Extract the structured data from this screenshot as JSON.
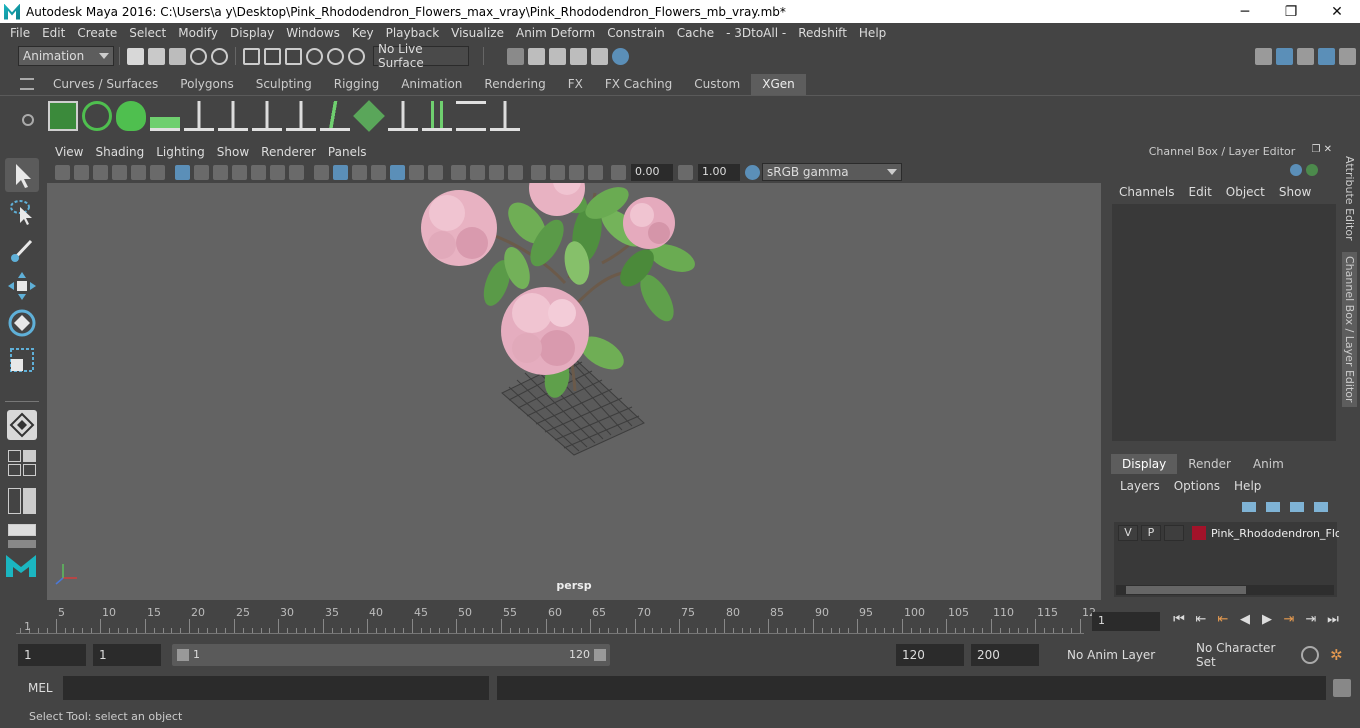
{
  "window": {
    "title": "Autodesk Maya 2016: C:\\Users\\a y\\Desktop\\Pink_Rhododendron_Flowers_max_vray\\Pink_Rhododendron_Flowers_mb_vray.mb*",
    "minimize": "─",
    "maximize": "❐",
    "close": "✕"
  },
  "menus": [
    "File",
    "Edit",
    "Create",
    "Select",
    "Modify",
    "Display",
    "Windows",
    "Key",
    "Playback",
    "Visualize",
    "Anim Deform",
    "Constrain",
    "Cache",
    "- 3DtoAll -",
    "Redshift",
    "Help"
  ],
  "status": {
    "mode": "Animation",
    "live_surface": "No Live Surface"
  },
  "shelf_tabs": [
    "Curves / Surfaces",
    "Polygons",
    "Sculpting",
    "Rigging",
    "Animation",
    "Rendering",
    "FX",
    "FX Caching",
    "Custom",
    "XGen"
  ],
  "shelf_active": "XGen",
  "viewport": {
    "menus": [
      "View",
      "Shading",
      "Lighting",
      "Show",
      "Renderer",
      "Panels"
    ],
    "near": "0.00",
    "far": "1.00",
    "color_space": "sRGB gamma",
    "camera": "persp"
  },
  "channel_box": {
    "title": "Channel Box / Layer Editor",
    "menus": [
      "Channels",
      "Edit",
      "Object",
      "Show"
    ]
  },
  "layer_editor": {
    "tabs": [
      "Display",
      "Render",
      "Anim"
    ],
    "active_tab": "Display",
    "menus": [
      "Layers",
      "Options",
      "Help"
    ],
    "layer": {
      "v": "V",
      "p": "P",
      "name": "Pink_Rhododendron_Flo",
      "color": "#a3132a"
    }
  },
  "side_tabs": [
    "Attribute Editor",
    "Channel Box / Layer Editor"
  ],
  "timeline": {
    "ticks": [
      "5",
      "10",
      "15",
      "20",
      "25",
      "30",
      "35",
      "40",
      "45",
      "50",
      "55",
      "60",
      "65",
      "70",
      "75",
      "80",
      "85",
      "90",
      "95",
      "100",
      "105",
      "110",
      "115",
      "12"
    ],
    "start_label": "1",
    "current_frame": "1"
  },
  "range": {
    "start": "1",
    "playback_start": "1",
    "slider_start": "1",
    "slider_end": "120",
    "playback_end": "120",
    "end": "200",
    "anim_layer": "No Anim Layer",
    "char_set": "No Character Set"
  },
  "command": {
    "label": "MEL"
  },
  "help": "Select Tool: select an object"
}
